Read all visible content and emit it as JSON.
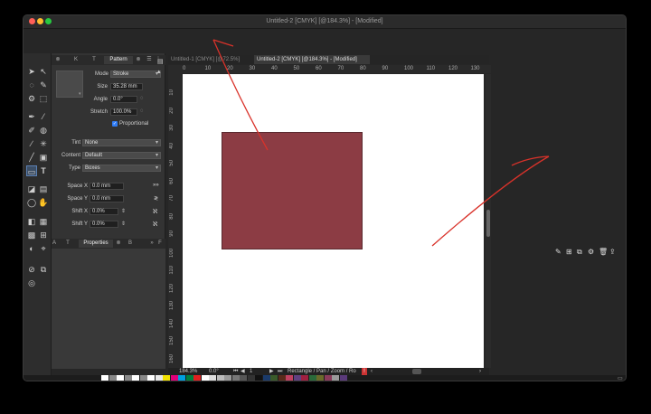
{
  "window": {
    "title": "Untitled-2 [CMYK] [@184.3%] - [Modified]"
  },
  "doc_tabs": [
    {
      "label": "Untitled-1 [CMYK] [@72.5%]",
      "active": false
    },
    {
      "label": "Untitled-2 [CMYK] [@184.3%] - [Modified]",
      "active": true
    }
  ],
  "panel": {
    "tabs": [
      "K",
      "T",
      "Pattern"
    ],
    "mode_label": "Mode",
    "mode_value": "Stroke",
    "size_label": "Size",
    "size_value": "35.28 mm",
    "angle_label": "Angle",
    "angle_value": "0.0°",
    "stretch_label": "Stretch",
    "stretch_value": "100.0%",
    "proportional_label": "Proportional",
    "tint_label": "Tint",
    "tint_value": "None",
    "content_label": "Content",
    "content_value": "Default",
    "type_label": "Type",
    "type_value": "Boxes",
    "spacex_label": "Space X",
    "spacex_value": "0.0 mm",
    "spacey_label": "Space Y",
    "spacey_value": "0.0 mm",
    "shiftx_label": "Shift X",
    "shiftx_value": "0.0%",
    "shifty_label": "Shift Y",
    "shifty_value": "0.0%",
    "bottom_tabs": [
      "A",
      "T",
      "Properties",
      "B",
      "F"
    ]
  },
  "ruler_h": [
    "0",
    "10",
    "20",
    "30",
    "40",
    "50",
    "60",
    "70",
    "80",
    "90",
    "100",
    "110",
    "120",
    "130"
  ],
  "ruler_v": [
    "10",
    "20",
    "30",
    "40",
    "50",
    "60",
    "70",
    "80",
    "90",
    "100",
    "110",
    "120",
    "130",
    "140",
    "150",
    "160"
  ],
  "status": {
    "zoom": "184.3%",
    "angle": "0.0°",
    "page": "1",
    "tool": "Rectangle / Pan / Zoom / Ro"
  },
  "colors": {
    "shape": "#8c3c44",
    "annotation": "#d9322a"
  }
}
